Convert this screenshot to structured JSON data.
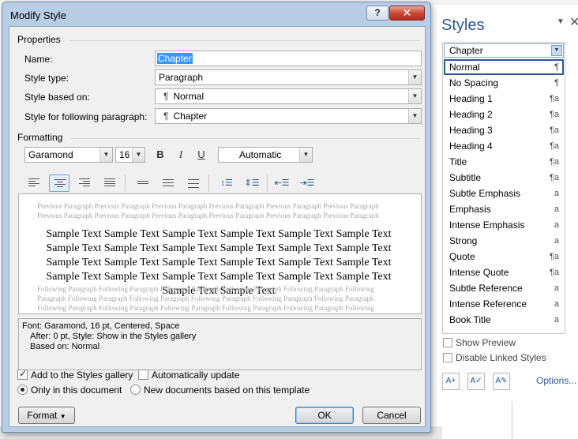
{
  "dialog": {
    "title": "Modify Style",
    "help_glyph": "?",
    "close_glyph": "✕",
    "properties": {
      "section": "Properties",
      "name_label": "Name:",
      "name_value": "Chapter",
      "type_label": "Style type:",
      "type_value": "Paragraph",
      "based_label": "Style based on:",
      "based_value": "Normal",
      "following_label": "Style for following paragraph:",
      "following_value": "Chapter",
      "pilcrow": "¶"
    },
    "formatting": {
      "section": "Formatting",
      "font": "Garamond",
      "size": "16",
      "bold": "B",
      "italic": "I",
      "underline": "U",
      "color": "Automatic"
    },
    "preview": {
      "previous": "Previous Paragraph Previous Paragraph Previous Paragraph Previous Paragraph Previous Paragraph Previous Paragraph Previous Paragraph Previous Paragraph Previous Paragraph Previous Paragraph Previous Paragraph Previous Paragraph Previous Paragraph Previous Paragraph",
      "sample": "Sample Text Sample Text Sample Text Sample Text Sample Text Sample Text Sample Text Sample Text Sample Text Sample Text Sample Text Sample Text Sample Text Sample Text Sample Text Sample Text Sample Text Sample Text Sample Text Sample Text Sample Text Sample Text Sample Text Sample Text Sample Text Sample Text",
      "following": "Following Paragraph Following Paragraph Following Paragraph Following Paragraph Following Paragraph Following Paragraph Following Paragraph Following Paragraph Following Paragraph Following Paragraph Following Paragraph Following Paragraph Following Paragraph Following Paragraph Following Paragraph Following Paragraph Following Paragraph Following Paragraph Following Paragraph Following Paragraph"
    },
    "description": {
      "line1": "Font: Garamond, 16 pt, Centered, Space",
      "line2": "After:  0 pt, Style: Show in the Styles gallery",
      "line3": "Based on: Normal"
    },
    "options": {
      "add_gallery": "Add to the Styles gallery",
      "auto_update": "Automatically update",
      "only_doc": "Only in this document",
      "new_docs": "New documents based on this template"
    },
    "buttons": {
      "format": "Format",
      "ok": "OK",
      "cancel": "Cancel"
    }
  },
  "styles_pane": {
    "title": "Styles",
    "current": "Chapter",
    "items": [
      {
        "label": "Normal",
        "mark": "¶"
      },
      {
        "label": "No Spacing",
        "mark": "¶"
      },
      {
        "label": "Heading 1",
        "mark": "¶a"
      },
      {
        "label": "Heading 2",
        "mark": "¶a"
      },
      {
        "label": "Heading 3",
        "mark": "¶a"
      },
      {
        "label": "Heading 4",
        "mark": "¶a"
      },
      {
        "label": "Title",
        "mark": "¶a"
      },
      {
        "label": "Subtitle",
        "mark": "¶a"
      },
      {
        "label": "Subtle Emphasis",
        "mark": "a"
      },
      {
        "label": "Emphasis",
        "mark": "a"
      },
      {
        "label": "Intense Emphasis",
        "mark": "a"
      },
      {
        "label": "Strong",
        "mark": "a"
      },
      {
        "label": "Quote",
        "mark": "¶a"
      },
      {
        "label": "Intense Quote",
        "mark": "¶a"
      },
      {
        "label": "Subtle Reference",
        "mark": "a"
      },
      {
        "label": "Intense Reference",
        "mark": "a"
      },
      {
        "label": "Book Title",
        "mark": "a"
      }
    ],
    "show_preview": "Show Preview",
    "disable_linked": "Disable Linked Styles",
    "options_link": "Options..."
  }
}
